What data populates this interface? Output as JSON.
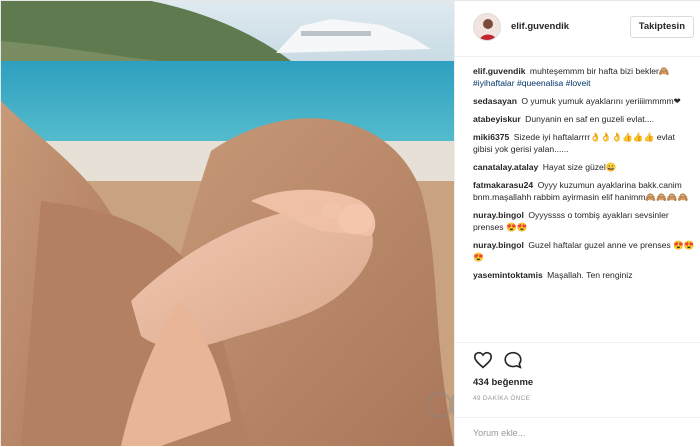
{
  "post": {
    "username": "elif.guvendik",
    "follow_label": "Takiptesin",
    "caption": {
      "user": "elif.guvendik",
      "text": "muhteşemmm bir hafta bizi bekler🙈",
      "tags": "#iyihaftalar #queenalisa #loveit"
    },
    "comments": [
      {
        "user": "sedasayan",
        "text": "O yumuk yumuk ayaklarını yeriiiimmmm❤"
      },
      {
        "user": "atabeyiskur",
        "text": "Dunyanin en saf en guzeli evlat...."
      },
      {
        "user": "miki6375",
        "text": "Sizede iyi haftalarrrr👌👌👌👍👍👍 evlat gibisi yok gerisi yalan......"
      },
      {
        "user": "canatalay.atalay",
        "text": "Hayat size güzel😀"
      },
      {
        "user": "fatmakarasu24",
        "text": "Oyyy kuzumun ayaklarina bakk.canim bnm.maşallahh rabbim ayirmasin elif hanimm🙈🙈🙈🙈"
      },
      {
        "user": "nuray.bingol",
        "text": "Oyyyssss o tombiş ayakları sevsinler prenses 😍😍"
      },
      {
        "user": "nuray.bingol",
        "text": "Guzel haftalar guzel anne ve prenses 😍😍😍"
      },
      {
        "user": "yasemintoktamis",
        "text": "Maşallah. Ten renginiz"
      }
    ],
    "likes": "434 beğenme",
    "time": "49 DAKİKA ÖNCE",
    "add_comment_placeholder": "Yorum ekle...",
    "icons": {
      "like": "heart-icon",
      "comment": "comment-icon"
    },
    "colors": {
      "hashtag": "#003569",
      "border": "#efefef",
      "muted": "#999999"
    }
  }
}
